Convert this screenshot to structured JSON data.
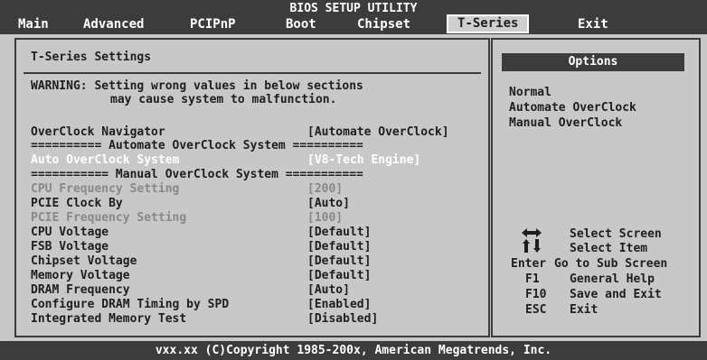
{
  "header": {
    "title": "BIOS SETUP UTILITY",
    "menu": [
      "Main",
      "Advanced",
      "PCIPnP",
      "Boot",
      "Chipset",
      "T-Series",
      "Exit"
    ]
  },
  "left": {
    "section_title": "T-Series Settings",
    "warning_line1": "WARNING: Setting wrong values in below sections",
    "warning_line2": "may cause system to malfunction.",
    "items": [
      {
        "label": "OverClock Navigator",
        "value": "[Automate OverClock]"
      },
      {
        "label": "========== Automate OverClock System =========="
      },
      {
        "label": "Auto OverClock System",
        "value": "[V8-Tech Engine]"
      },
      {
        "label": "=========== Manual OverClock System ==========="
      },
      {
        "label": "CPU Frequency Setting",
        "value": "[200]"
      },
      {
        "label": "PCIE Clock By",
        "value": "[Auto]"
      },
      {
        "label": "PCIE Frequency Setting",
        "value": "[100]"
      },
      {
        "label": "CPU Voltage",
        "value": "[Default]"
      },
      {
        "label": "FSB Voltage",
        "value": "[Default]"
      },
      {
        "label": "Chipset Voltage",
        "value": "[Default]"
      },
      {
        "label": "Memory Voltage",
        "value": "[Default]"
      },
      {
        "label": "DRAM Frequency",
        "value": "[Auto]"
      },
      {
        "label": "Configure DRAM Timing by SPD",
        "value": "[Enabled]"
      },
      {
        "label": "Integrated Memory Test",
        "value": "[Disabled]"
      }
    ]
  },
  "right": {
    "options_title": "Options",
    "options": [
      "Normal",
      "Automate OverClock",
      "Manual OverClock"
    ],
    "help": [
      {
        "key": "",
        "text": "Select Screen",
        "icon": "left-right-arrows-icon"
      },
      {
        "key": "",
        "text": "Select Item",
        "icon": "up-down-arrows-icon"
      },
      {
        "key": "Enter",
        "text": "Go to Sub Screen"
      },
      {
        "key": "F1",
        "text": "General Help"
      },
      {
        "key": "F10",
        "text": "Save and Exit"
      },
      {
        "key": "ESC",
        "text": "Exit"
      }
    ]
  },
  "footer": "vxx.xx (C)Copyright 1985-200x, American Megatrends, Inc.",
  "colors": {
    "background": "#c8c8c8",
    "bar": "#3c3c3c",
    "highlight": "#ffffff",
    "disabled": "#888888"
  }
}
